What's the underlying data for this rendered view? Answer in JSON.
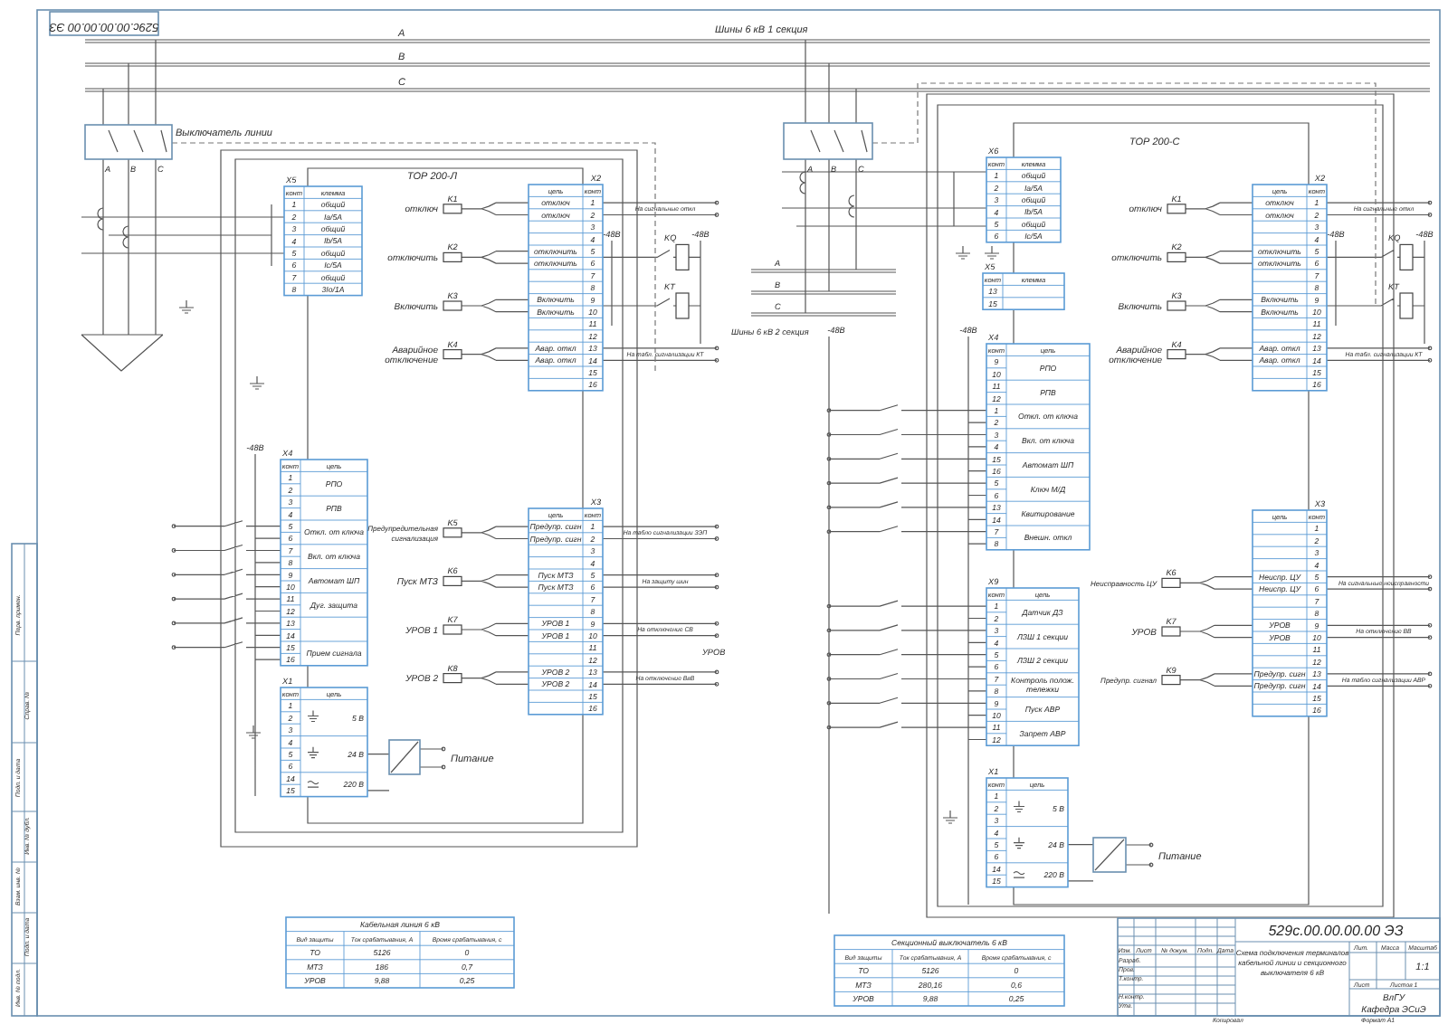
{
  "drawing_code": "529с.00.00.00.00 ЭЗ",
  "bus_1": {
    "phases": [
      "A",
      "B",
      "C"
    ],
    "title": "Шины 6 кВ 1 секция"
  },
  "line_breaker": {
    "label": "Выключатель линии",
    "phases": [
      "A",
      "B",
      "C"
    ]
  },
  "section_breaker": {
    "phases": [
      "A",
      "B",
      "C"
    ]
  },
  "bus_2": {
    "phases": [
      "A",
      "B",
      "C"
    ],
    "title": "Шины 6 кВ 2 секция"
  },
  "left_terminal": {
    "title": "ТОР 200-Л",
    "blocks": [
      {
        "label": "X5",
        "header": [
          "конт",
          "клемма"
        ],
        "groups": [
          {
            "nums": [
              "1"
            ],
            "name": "общий"
          },
          {
            "nums": [
              "2"
            ],
            "name": "Ia/5А"
          },
          {
            "nums": [
              "3"
            ],
            "name": "общий"
          },
          {
            "nums": [
              "4"
            ],
            "name": "Ib/5А"
          },
          {
            "nums": [
              "5"
            ],
            "name": "общий"
          },
          {
            "nums": [
              "6"
            ],
            "name": "Ic/5А"
          },
          {
            "nums": [
              "7"
            ],
            "name": "общий"
          },
          {
            "nums": [
              "8"
            ],
            "name": "3Io/1А"
          }
        ]
      },
      {
        "label": "X2",
        "header": [
          "цепь",
          "конт"
        ],
        "groups": [
          {
            "nums": [
              "1"
            ],
            "name": "отключ"
          },
          {
            "nums": [
              "2"
            ],
            "name": "отключ"
          },
          {
            "nums": [
              "3"
            ]
          },
          {
            "nums": [
              "4"
            ]
          },
          {
            "nums": [
              "5"
            ],
            "name": "отключить"
          },
          {
            "nums": [
              "6"
            ],
            "name": "отключить"
          },
          {
            "nums": [
              "7"
            ]
          },
          {
            "nums": [
              "8"
            ]
          },
          {
            "nums": [
              "9"
            ],
            "name": "Включить"
          },
          {
            "nums": [
              "10"
            ],
            "name": "Включить"
          },
          {
            "nums": [
              "11"
            ]
          },
          {
            "nums": [
              "12"
            ]
          },
          {
            "nums": [
              "13"
            ],
            "name": "Авар. откл"
          },
          {
            "nums": [
              "14"
            ],
            "name": "Авар. откл"
          },
          {
            "nums": [
              "15"
            ]
          },
          {
            "nums": [
              "16"
            ]
          }
        ]
      },
      {
        "label": "X4",
        "header": [
          "конт",
          "цепь"
        ],
        "groups": [
          {
            "nums": [
              "1",
              "2"
            ],
            "name": "РПО"
          },
          {
            "nums": [
              "3",
              "4"
            ],
            "name": "РПВ"
          },
          {
            "nums": [
              "5",
              "6"
            ],
            "name": "Откл. от ключа"
          },
          {
            "nums": [
              "7",
              "8"
            ],
            "name": "Вкл. от ключа"
          },
          {
            "nums": [
              "9",
              "10"
            ],
            "name": "Автомат ШП"
          },
          {
            "nums": [
              "11",
              "12"
            ],
            "name": "Дуг. защита"
          },
          {
            "nums": [
              "13",
              "14"
            ]
          },
          {
            "nums": [
              "15",
              "16"
            ],
            "name": "Прием сигнала"
          }
        ]
      },
      {
        "label": "X3",
        "header": [
          "цепь",
          "конт"
        ],
        "groups": [
          {
            "nums": [
              "1"
            ],
            "name": "Предупр. сигн"
          },
          {
            "nums": [
              "2"
            ],
            "name": "Предупр. сигн"
          },
          {
            "nums": [
              "3"
            ]
          },
          {
            "nums": [
              "4"
            ]
          },
          {
            "nums": [
              "5"
            ],
            "name": "Пуск МТЗ"
          },
          {
            "nums": [
              "6"
            ],
            "name": "Пуск МТЗ"
          },
          {
            "nums": [
              "7"
            ]
          },
          {
            "nums": [
              "8"
            ]
          },
          {
            "nums": [
              "9"
            ],
            "name": "УРОВ 1"
          },
          {
            "nums": [
              "10"
            ],
            "name": "УРОВ 1"
          },
          {
            "nums": [
              "11"
            ]
          },
          {
            "nums": [
              "12"
            ]
          },
          {
            "nums": [
              "13"
            ],
            "name": "УРОВ 2"
          },
          {
            "nums": [
              "14"
            ],
            "name": "УРОВ 2"
          },
          {
            "nums": [
              "15"
            ]
          },
          {
            "nums": [
              "16"
            ]
          }
        ]
      },
      {
        "label": "X1",
        "header": [
          "конт",
          "цепь"
        ],
        "groups": [
          {
            "nums": [
              "1",
              "2",
              "3"
            ],
            "name": "5 В",
            "kind": "ground"
          },
          {
            "nums": [
              "4",
              "5",
              "6"
            ],
            "name": "24 В",
            "kind": "ground"
          },
          {
            "nums": [
              "14",
              "15"
            ],
            "name": "220 В",
            "kind": "ac"
          }
        ]
      }
    ],
    "relays": [
      {
        "id": "K1",
        "caption": "отключ"
      },
      {
        "id": "K2",
        "caption": "отключить"
      },
      {
        "id": "K3",
        "caption": "Включить"
      },
      {
        "id": "K4",
        "caption": "Аварийное отключение"
      },
      {
        "id": "K5",
        "caption": "Предупредительная сигнализация"
      },
      {
        "id": "K6",
        "caption": "Пуск МТЗ"
      },
      {
        "id": "K7",
        "caption": "УРОВ 1"
      },
      {
        "id": "K8",
        "caption": "УРОВ 2"
      }
    ],
    "aux_relays": [
      "KQ",
      "KT"
    ],
    "outputs": [
      "На сигнальные откл",
      "На табл. сигнализации КТ",
      "На табло сигнализации ЗЭП",
      "На защиту шин",
      "На отключение СВ",
      "На отключение ВвВ"
    ],
    "note": "УРОВ",
    "supply_labels": [
      "-48В",
      "-48В",
      "-48В"
    ],
    "power_label": "Питание"
  },
  "right_terminal": {
    "title": "ТОР 200-С",
    "blocks": [
      {
        "label": "X6",
        "header": [
          "конт",
          "клемма"
        ],
        "groups": [
          {
            "nums": [
              "1"
            ],
            "name": "общий"
          },
          {
            "nums": [
              "2"
            ],
            "name": "Ia/5А"
          },
          {
            "nums": [
              "3"
            ],
            "name": "общий"
          },
          {
            "nums": [
              "4"
            ],
            "name": "Ib/5А"
          },
          {
            "nums": [
              "5"
            ],
            "name": "общий"
          },
          {
            "nums": [
              "6"
            ],
            "name": "Ic/5А"
          }
        ]
      },
      {
        "label": "X5",
        "header": [
          "конт",
          "клемма"
        ],
        "groups": [
          {
            "nums": [
              "13"
            ]
          },
          {
            "nums": [
              "15"
            ]
          }
        ]
      },
      {
        "label": "X4",
        "header": [
          "конт",
          "цепь"
        ],
        "groups": [
          {
            "nums": [
              "9",
              "10"
            ],
            "name": "РПО"
          },
          {
            "nums": [
              "11",
              "12"
            ],
            "name": "РПВ"
          },
          {
            "nums": [
              "1",
              "2"
            ],
            "name": "Откл. от ключа"
          },
          {
            "nums": [
              "3",
              "4"
            ],
            "name": "Вкл. от ключа"
          },
          {
            "nums": [
              "15",
              "16"
            ],
            "name": "Автомат ШП"
          },
          {
            "nums": [
              "5",
              "6"
            ],
            "name": "Ключ М/Д"
          },
          {
            "nums": [
              "13",
              "14"
            ],
            "name": "Квитирование"
          },
          {
            "nums": [
              "7",
              "8"
            ],
            "name": "Внешн. откл"
          }
        ]
      },
      {
        "label": "X9",
        "header": [
          "конт",
          "цепь"
        ],
        "groups": [
          {
            "nums": [
              "1",
              "2"
            ],
            "name": "Датчик ДЗ"
          },
          {
            "nums": [
              "3",
              "4"
            ],
            "name": "ЛЗШ 1 секции"
          },
          {
            "nums": [
              "5",
              "6"
            ],
            "name": "ЛЗШ 2 секции"
          },
          {
            "nums": [
              "7",
              "8"
            ],
            "name": "Контроль полож. тележки"
          },
          {
            "nums": [
              "9",
              "10"
            ],
            "name": "Пуск АВР"
          },
          {
            "nums": [
              "11",
              "12"
            ],
            "name": "Запрет АВР"
          }
        ]
      },
      {
        "label": "X1",
        "header": [
          "конт",
          "цепь"
        ],
        "groups": [
          {
            "nums": [
              "1",
              "2",
              "3"
            ],
            "name": "5 В",
            "kind": "ground"
          },
          {
            "nums": [
              "4",
              "5",
              "6"
            ],
            "name": "24 В",
            "kind": "ground"
          },
          {
            "nums": [
              "14",
              "15"
            ],
            "name": "220 В",
            "kind": "ac"
          }
        ]
      },
      {
        "label": "X2",
        "header": [
          "цепь",
          "конт"
        ],
        "groups": [
          {
            "nums": [
              "1"
            ],
            "name": "отключ"
          },
          {
            "nums": [
              "2"
            ],
            "name": "отключ"
          },
          {
            "nums": [
              "3"
            ]
          },
          {
            "nums": [
              "4"
            ]
          },
          {
            "nums": [
              "5"
            ],
            "name": "отключить"
          },
          {
            "nums": [
              "6"
            ],
            "name": "отключить"
          },
          {
            "nums": [
              "7"
            ]
          },
          {
            "nums": [
              "8"
            ]
          },
          {
            "nums": [
              "9"
            ],
            "name": "Включить"
          },
          {
            "nums": [
              "10"
            ],
            "name": "Включить"
          },
          {
            "nums": [
              "11"
            ]
          },
          {
            "nums": [
              "12"
            ]
          },
          {
            "nums": [
              "13"
            ],
            "name": "Авар. откл"
          },
          {
            "nums": [
              "14"
            ],
            "name": "Авар. откл"
          },
          {
            "nums": [
              "15"
            ]
          },
          {
            "nums": [
              "16"
            ]
          }
        ]
      },
      {
        "label": "X3",
        "header": [
          "цепь",
          "конт"
        ],
        "groups": [
          {
            "nums": [
              "1"
            ]
          },
          {
            "nums": [
              "2"
            ]
          },
          {
            "nums": [
              "3"
            ]
          },
          {
            "nums": [
              "4"
            ]
          },
          {
            "nums": [
              "5"
            ],
            "name": "Неиспр. ЦУ"
          },
          {
            "nums": [
              "6"
            ],
            "name": "Неиспр. ЦУ"
          },
          {
            "nums": [
              "7"
            ]
          },
          {
            "nums": [
              "8"
            ]
          },
          {
            "nums": [
              "9"
            ],
            "name": "УРОВ"
          },
          {
            "nums": [
              "10"
            ],
            "name": "УРОВ"
          },
          {
            "nums": [
              "11"
            ]
          },
          {
            "nums": [
              "12"
            ]
          },
          {
            "nums": [
              "13"
            ],
            "name": "Предупр. сигн"
          },
          {
            "nums": [
              "14"
            ],
            "name": "Предупр. сигн"
          },
          {
            "nums": [
              "15"
            ]
          },
          {
            "nums": [
              "16"
            ]
          }
        ]
      }
    ],
    "relays": [
      {
        "id": "K1",
        "caption": "отключ"
      },
      {
        "id": "K2",
        "caption": "отключить"
      },
      {
        "id": "K3",
        "caption": "Включить"
      },
      {
        "id": "K4",
        "caption": "Аварийное отключение"
      },
      {
        "id": "K6",
        "caption": "Неисправность ЦУ"
      },
      {
        "id": "K7",
        "caption": "УРОВ"
      },
      {
        "id": "K9",
        "caption": "Предупр. сигнал"
      }
    ],
    "aux_relays": [
      "KQ",
      "KT"
    ],
    "outputs": [
      "На сигнальные откл",
      "На табл. сигнализации КТ",
      "На сигнальные неисправности",
      "На отключение ВВ",
      "На табло сигнализации АВР"
    ],
    "supply_labels": [
      "-48В",
      "-48В",
      "-48В",
      "-48В"
    ],
    "power_label": "Питание"
  },
  "tables": [
    {
      "title": "Кабельная линия 6 кВ",
      "columns": [
        "Вид защиты",
        "Ток срабатывания, А",
        "Время срабатывания, с"
      ],
      "rows": [
        [
          "ТО",
          "5126",
          "0"
        ],
        [
          "МТЗ",
          "186",
          "0,7"
        ],
        [
          "УРОВ",
          "9,88",
          "0,25"
        ]
      ]
    },
    {
      "title": "Секционный выключатель 6 кВ",
      "columns": [
        "Вид защиты",
        "Ток срабатывания, А",
        "Время срабатывания, с"
      ],
      "rows": [
        [
          "ТО",
          "5126",
          "0"
        ],
        [
          "МТЗ",
          "280,16",
          "0,6"
        ],
        [
          "УРОВ",
          "9,88",
          "0,25"
        ]
      ]
    }
  ],
  "title_block": {
    "code": "529с.00.00.00.00 ЭЗ",
    "caption": "Схема подключения терминалов кабельной линии и секционного выключателя 6 кВ",
    "columns": [
      "Изм.",
      "Лист",
      "№ докум.",
      "Подп.",
      "Дата"
    ],
    "roles": [
      "Разраб.",
      "Пров.",
      "Т.контр.",
      "Н.контр.",
      "Утв."
    ],
    "attribute_headers": [
      "Лит.",
      "Масса",
      "Масштаб"
    ],
    "scale": "1:1",
    "sheet": "Лист",
    "sheets": "Листов 1",
    "org": "ВлГУ",
    "dept": "Кафедра ЭСиЭ",
    "copied": "Копировал",
    "format": "Формат А1"
  },
  "margin_labels": [
    "Перв. примен.",
    "Справ. №",
    "Подп. и дата",
    "Инв. № дубл.",
    "Взам. инв. №",
    "Подп. и дата",
    "Инв. № подл."
  ]
}
